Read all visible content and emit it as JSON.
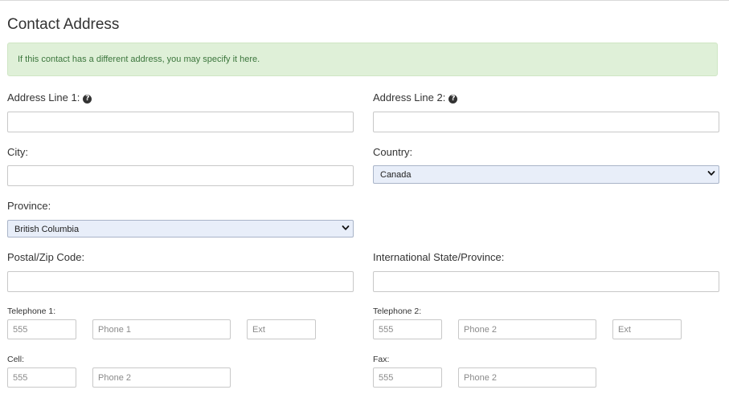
{
  "page": {
    "title": "Contact Address"
  },
  "alert": {
    "text": "If this contact has a different address, you may specify it here."
  },
  "form": {
    "address_line_1": {
      "label": "Address Line 1:",
      "value": ""
    },
    "address_line_2": {
      "label": "Address Line 2:",
      "value": ""
    },
    "city": {
      "label": "City:",
      "value": ""
    },
    "country": {
      "label": "Country:",
      "selected": "Canada"
    },
    "province": {
      "label": "Province:",
      "selected": "British Columbia"
    },
    "postal_code": {
      "label": "Postal/Zip Code:",
      "value": ""
    },
    "intl_state": {
      "label": "International State/Province:",
      "value": ""
    },
    "telephone1": {
      "label": "Telephone 1:",
      "area_placeholder": "555",
      "number_placeholder": "Phone 1",
      "ext_placeholder": "Ext"
    },
    "telephone2": {
      "label": "Telephone 2:",
      "area_placeholder": "555",
      "number_placeholder": "Phone 2",
      "ext_placeholder": "Ext"
    },
    "cell": {
      "label": "Cell:",
      "area_placeholder": "555",
      "number_placeholder": "Phone 2"
    },
    "fax": {
      "label": "Fax:",
      "area_placeholder": "555",
      "number_placeholder": "Phone 2"
    }
  },
  "icons": {
    "help": "question-circle-icon",
    "select_arrow": "chevron-down-icon"
  }
}
